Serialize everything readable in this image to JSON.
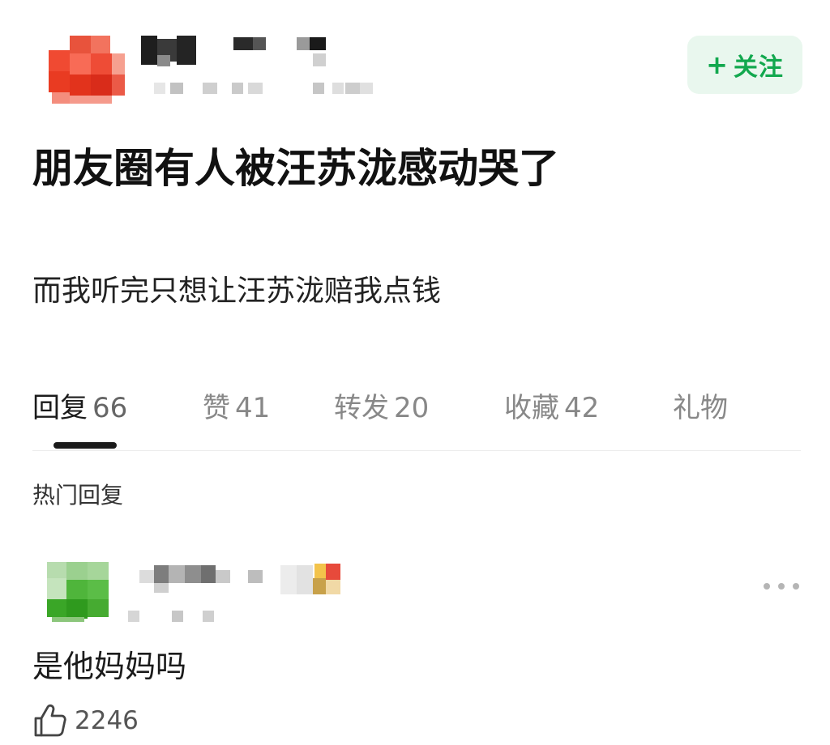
{
  "post": {
    "follow_label": "关注",
    "title": "朋友圈有人被汪苏泷感动哭了",
    "body": "而我听完只想让汪苏泷赔我点钱"
  },
  "tabs": [
    {
      "label": "回复",
      "count": "66",
      "active": true
    },
    {
      "label": "赞",
      "count": "41",
      "active": false
    },
    {
      "label": "转发",
      "count": "20",
      "active": false
    },
    {
      "label": "收藏",
      "count": "42",
      "active": false
    },
    {
      "label": "礼物",
      "count": "",
      "active": false
    }
  ],
  "section": {
    "label": "热门回复"
  },
  "comment": {
    "text": "是他妈妈吗",
    "like_count": "2246"
  },
  "colors": {
    "accent_green": "#12a84e",
    "follow_bg": "#e9f7ee"
  },
  "icons": {
    "follow": "plus-icon",
    "more": "more-dots-icon",
    "like": "thumbs-up-icon"
  }
}
